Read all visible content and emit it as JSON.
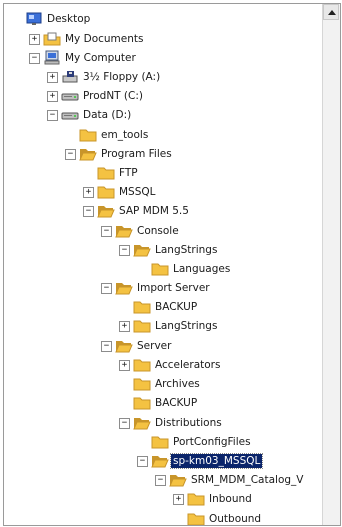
{
  "tree": {
    "nodes": [
      {
        "label": "Desktop",
        "icon": "desktop-icon",
        "expander": null
      },
      {
        "label": "My Documents",
        "icon": "my-documents-icon",
        "expander": "+"
      },
      {
        "label": "My Computer",
        "icon": "my-computer-icon",
        "expander": "-"
      },
      {
        "label": "3½ Floppy (A:)",
        "icon": "floppy-drive-icon",
        "expander": "+"
      },
      {
        "label": "ProdNT (C:)",
        "icon": "hard-drive-icon",
        "expander": "+"
      },
      {
        "label": "Data (D:)",
        "icon": "hard-drive-icon",
        "expander": "-"
      },
      {
        "label": "em_tools",
        "icon": "folder-icon",
        "expander": null
      },
      {
        "label": "Program Files",
        "icon": "folder-open-icon",
        "expander": "-"
      },
      {
        "label": "FTP",
        "icon": "folder-icon",
        "expander": null
      },
      {
        "label": "MSSQL",
        "icon": "folder-icon",
        "expander": "+"
      },
      {
        "label": "SAP MDM 5.5",
        "icon": "folder-open-icon",
        "expander": "-"
      },
      {
        "label": "Console",
        "icon": "folder-open-icon",
        "expander": "-"
      },
      {
        "label": "LangStrings",
        "icon": "folder-open-icon",
        "expander": "-"
      },
      {
        "label": "Languages",
        "icon": "folder-icon",
        "expander": null
      },
      {
        "label": "Import Server",
        "icon": "folder-open-icon",
        "expander": "-"
      },
      {
        "label": "BACKUP",
        "icon": "folder-icon",
        "expander": null
      },
      {
        "label": "LangStrings",
        "icon": "folder-icon",
        "expander": "+"
      },
      {
        "label": "Server",
        "icon": "folder-open-icon",
        "expander": "-"
      },
      {
        "label": "Accelerators",
        "icon": "folder-icon",
        "expander": "+"
      },
      {
        "label": "Archives",
        "icon": "folder-icon",
        "expander": null
      },
      {
        "label": "BACKUP",
        "icon": "folder-icon",
        "expander": null
      },
      {
        "label": "Distributions",
        "icon": "folder-open-icon",
        "expander": "-"
      },
      {
        "label": "PortConfigFiles",
        "icon": "folder-icon",
        "expander": null
      },
      {
        "label": "sp-km03_MSSQL",
        "icon": "folder-open-icon",
        "expander": "-",
        "selected": true
      },
      {
        "label": "SRM_MDM_Catalog_V",
        "icon": "folder-open-icon",
        "expander": "-"
      },
      {
        "label": "Inbound",
        "icon": "folder-icon",
        "expander": "+"
      },
      {
        "label": "Outbound",
        "icon": "folder-icon",
        "expander": null
      }
    ]
  },
  "colors": {
    "selection": "#0a246a",
    "folder": "#f4c242",
    "folder_dark": "#c8952a"
  }
}
